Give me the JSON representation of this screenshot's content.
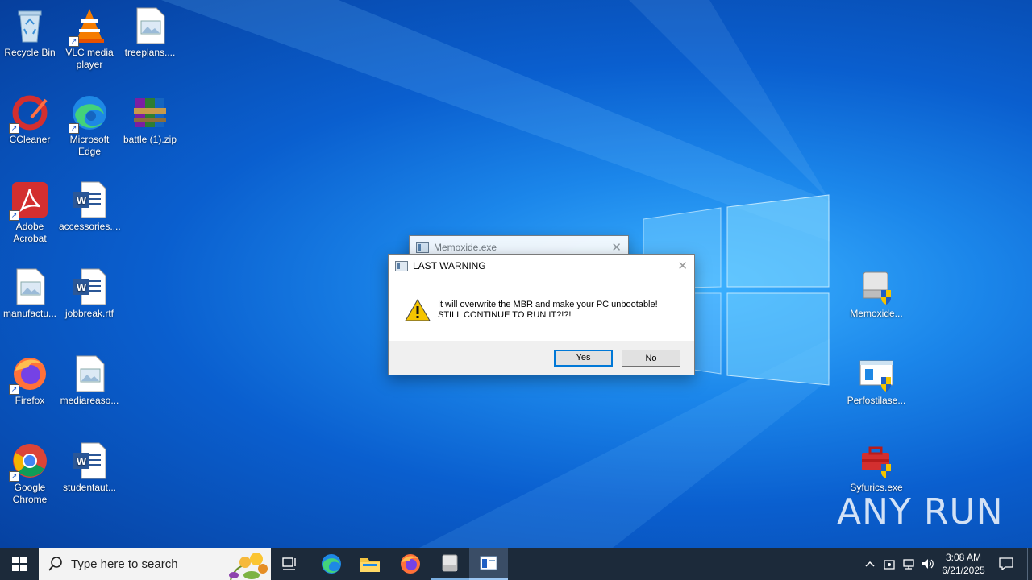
{
  "desktop": {
    "icons": [
      {
        "label": "Recycle Bin",
        "icon": "recycle-bin-icon"
      },
      {
        "label": "VLC media player",
        "icon": "vlc-icon"
      },
      {
        "label": "treeplans....",
        "icon": "image-file-icon"
      },
      {
        "label": "CCleaner",
        "icon": "ccleaner-icon"
      },
      {
        "label": "Microsoft Edge",
        "icon": "edge-icon"
      },
      {
        "label": "battle (1).zip",
        "icon": "winrar-icon"
      },
      {
        "label": "Adobe Acrobat",
        "icon": "acrobat-icon"
      },
      {
        "label": "accessories....",
        "icon": "word-file-icon"
      },
      {
        "label": "manufactu...",
        "icon": "image-file-icon"
      },
      {
        "label": "jobbreak.rtf",
        "icon": "word-file-icon"
      },
      {
        "label": "Firefox",
        "icon": "firefox-icon"
      },
      {
        "label": "mediareaso...",
        "icon": "image-file-icon"
      },
      {
        "label": "Google Chrome",
        "icon": "chrome-icon"
      },
      {
        "label": "studentaut...",
        "icon": "word-file-icon"
      },
      {
        "label": "Memoxide...",
        "icon": "drive-shield-icon"
      },
      {
        "label": "Perfostilase...",
        "icon": "installer-shield-icon"
      },
      {
        "label": "Syfurics.exe",
        "icon": "toolbox-shield-icon"
      }
    ]
  },
  "back_dialog": {
    "title": "Memoxide.exe"
  },
  "dialog": {
    "title": "LAST WARNING",
    "message_line1": "It will overwrite the MBR and make your PC unbootable!",
    "message_line2": "STILL CONTINUE TO RUN IT?!?!",
    "yes_label": "Yes",
    "no_label": "No"
  },
  "taskbar": {
    "search_placeholder": "Type here to search",
    "time": "3:08 AM",
    "date": "6/21/2025"
  },
  "watermark": "ANY RUN",
  "colors": {
    "taskbar": "#1c2a3a",
    "desktop": "#0a5fcf",
    "accent": "#0078d7"
  }
}
